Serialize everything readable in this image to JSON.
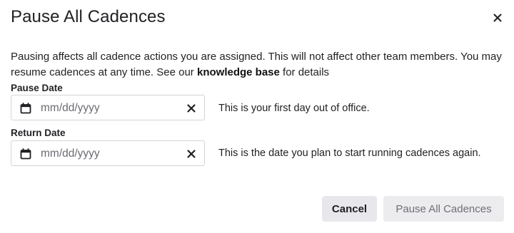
{
  "dialog": {
    "title": "Pause All Cadences",
    "close_icon": "close-icon",
    "description": {
      "text_before": "Pausing affects all cadence actions you are assigned. This will not affect other team members. You may resume cadences at any time. See our ",
      "link_text": "knowledge base",
      "text_after": " for details"
    },
    "pause_date": {
      "label": "Pause Date",
      "placeholder": "mm/dd/yyyy",
      "value": "",
      "icon": "calendar-icon",
      "clear_icon": "clear-icon",
      "hint": "This is your first day out of office."
    },
    "return_date": {
      "label": "Return Date",
      "placeholder": "mm/dd/yyyy",
      "value": "",
      "icon": "calendar-icon",
      "clear_icon": "clear-icon",
      "hint": "This is the date you plan to start running cadences again."
    },
    "buttons": {
      "cancel_label": "Cancel",
      "confirm_label": "Pause All Cadences",
      "confirm_disabled": true
    },
    "colors": {
      "text": "#222226",
      "border": "#d4d4d8",
      "cancel_bg": "#e8e8ec",
      "disabled_bg": "#ececef",
      "disabled_text": "#6e6e76"
    }
  }
}
